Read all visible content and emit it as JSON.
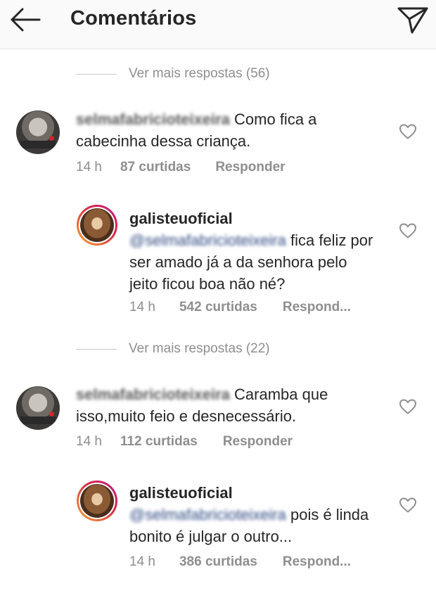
{
  "header": {
    "title": "Comentários",
    "back_icon": "arrow-left-icon",
    "send_icon": "paper-plane-icon"
  },
  "threads": [
    {
      "more_replies": "Ver mais respostas (56)",
      "comment": {
        "username": "selmafabricioteixeira",
        "text": " Como fica a cabecinha dessa criança.",
        "time": "14 h",
        "likes": "87 curtidas",
        "reply": "Responder"
      },
      "reply": {
        "username": "galisteuoficial",
        "mention": "@selmafabricioteixeira",
        "text": " fica feliz por ser amado já a da senhora pelo jeito ficou boa não né?",
        "time": "14 h",
        "likes": "542 curtidas",
        "reply": "Respond..."
      }
    },
    {
      "more_replies": "Ver mais respostas (22)",
      "comment": {
        "username": "selmafabricioteixeira",
        "text": " Caramba que isso,muito feio e desnecessário.",
        "time": "14 h",
        "likes": "112 curtidas",
        "reply": "Responder"
      },
      "reply": {
        "username": "galisteuoficial",
        "mention": "@selmafabricioteixeira",
        "text": " pois é linda bonito é julgar o outro...",
        "time": "14 h",
        "likes": "386 curtidas",
        "reply": "Respond..."
      }
    }
  ],
  "colors": {
    "text": "#262626",
    "secondary": "#8e8e8e",
    "mention": "#2f4a83",
    "header_bg": "#fafafa"
  }
}
